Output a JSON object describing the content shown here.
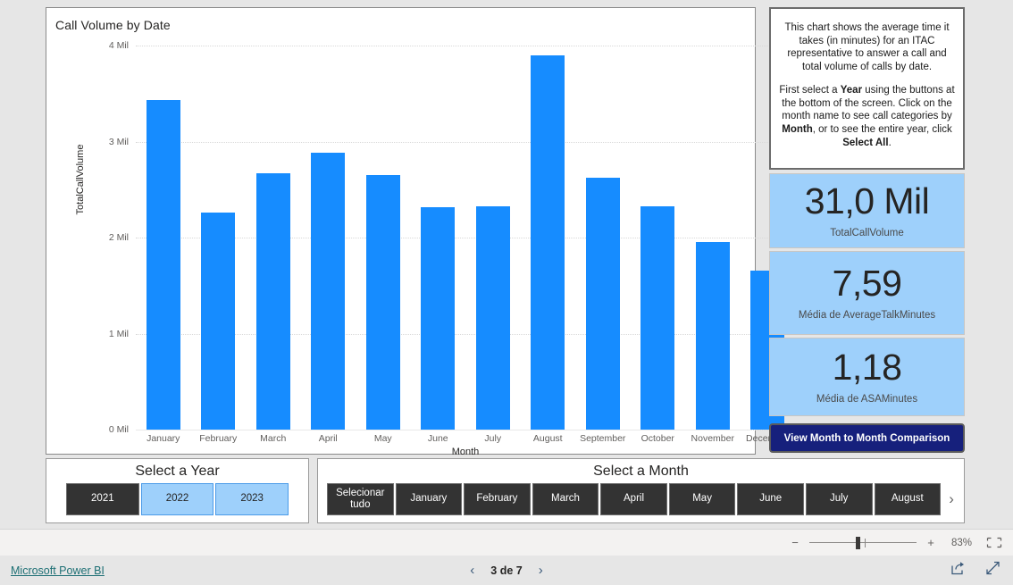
{
  "chart_data": {
    "type": "bar",
    "title": "Call Volume by Date",
    "xlabel": "Month",
    "ylabel": "TotalCallVolume",
    "categories": [
      "January",
      "February",
      "March",
      "April",
      "May",
      "June",
      "July",
      "August",
      "September",
      "October",
      "November",
      "December"
    ],
    "values": [
      3.43,
      2.26,
      2.67,
      2.88,
      2.65,
      2.32,
      2.33,
      3.9,
      2.62,
      2.33,
      1.95,
      1.66
    ],
    "value_unit": "Mil",
    "ylim": [
      0,
      4
    ],
    "ytick_labels": [
      "0 Mil",
      "1 Mil",
      "2 Mil",
      "3 Mil",
      "4 Mil"
    ],
    "ytick_values": [
      0,
      1,
      2,
      3,
      4
    ],
    "grid": true,
    "legend": false,
    "bar_color": "#168CFF"
  },
  "info_panel": {
    "paragraph_1_a": "This chart shows the average time it takes (in minutes) for an ITAC representative to answer a call and total volume of calls by date.",
    "p2_part1": "First select a ",
    "p2_bold1": "Year",
    "p2_part2": " using the buttons at the bottom of the screen. Click on the month name to see call categories by ",
    "p2_bold2": "Month",
    "p2_part3": ", or to see the entire year, click ",
    "p2_bold3": "Select All",
    "p2_part4": "."
  },
  "kpis": [
    {
      "value": "31,0 Mil",
      "label": "TotalCallVolume"
    },
    {
      "value": "7,59",
      "label": "Média de AverageTalkMinutes"
    },
    {
      "value": "1,18",
      "label": "Média de ASAMinutes"
    }
  ],
  "compare_button": {
    "label": "View Month to Month Comparison"
  },
  "year_slicer": {
    "title": "Select a Year",
    "items": [
      {
        "label": "2021",
        "selected": true
      },
      {
        "label": "2022",
        "selected": false
      },
      {
        "label": "2023",
        "selected": false
      }
    ]
  },
  "month_slicer": {
    "title": "Select a Month",
    "items": [
      {
        "label": "Selecionar tudo",
        "selected": true
      },
      {
        "label": "January",
        "selected": true
      },
      {
        "label": "February",
        "selected": true
      },
      {
        "label": "March",
        "selected": true
      },
      {
        "label": "April",
        "selected": true
      },
      {
        "label": "May",
        "selected": true
      },
      {
        "label": "June",
        "selected": true
      },
      {
        "label": "July",
        "selected": true
      },
      {
        "label": "August",
        "selected": true
      }
    ],
    "next_glyph": "›"
  },
  "zoom_bar": {
    "minus": "−",
    "plus": "+",
    "value": "83%"
  },
  "footer": {
    "brand_link": "Microsoft Power BI",
    "prev_glyph": "‹",
    "page_label": "3 de 7",
    "next_glyph": "›"
  },
  "colors": {
    "bar_blue": "#168CFF",
    "kpi_bg": "#9ed0fb",
    "slicer_selected_bg": "#333333",
    "button_navy": "#16207c",
    "link_teal": "#1d6f74"
  }
}
